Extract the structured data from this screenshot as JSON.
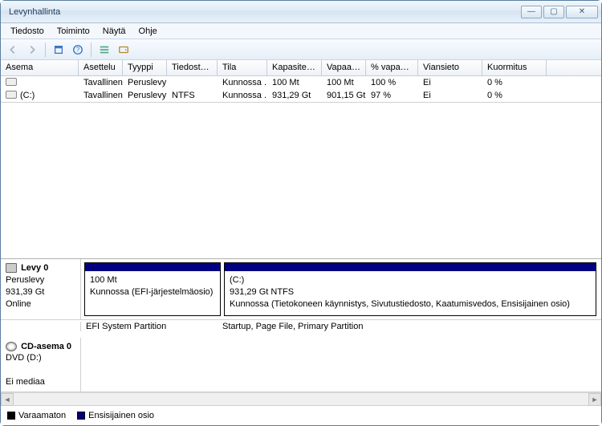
{
  "window": {
    "title": "Levynhallinta"
  },
  "menu": {
    "tiedosto": "Tiedosto",
    "toiminto": "Toiminto",
    "nayta": "Näytä",
    "ohje": "Ohje"
  },
  "columns": {
    "asema": "Asema",
    "asettelu": "Asettelu",
    "tyyppi": "Tyyppi",
    "tj": "Tiedostojärj...",
    "tila": "Tila",
    "kap": "Kapasiteetti",
    "vapaa": "Vapaa tila",
    "pct": "% vapaana",
    "vian": "Viansieto",
    "kuorm": "Kuormitus"
  },
  "volumes": [
    {
      "asema": "",
      "asettelu": "Tavallinen",
      "tyyppi": "Peruslevy",
      "tj": "",
      "tila": "Kunnossa ...",
      "kap": "100 Mt",
      "vapaa": "100 Mt",
      "pct": "100 %",
      "vian": "Ei",
      "kuorm": "0 %"
    },
    {
      "asema": "(C:)",
      "asettelu": "Tavallinen",
      "tyyppi": "Peruslevy",
      "tj": "NTFS",
      "tila": "Kunnossa ...",
      "kap": "931,29 Gt",
      "vapaa": "901,15 Gt",
      "pct": "97 %",
      "vian": "Ei",
      "kuorm": "0 %"
    }
  ],
  "disk0": {
    "title": "Levy 0",
    "type": "Peruslevy",
    "size": "931,39 Gt",
    "status": "Online",
    "vol1": {
      "line1": "",
      "line2": "100 Mt",
      "line3": "Kunnossa (EFI-järjestelmäosio)"
    },
    "vol2": {
      "line1": "(C:)",
      "line2": "931,29 Gt NTFS",
      "line3": "Kunnossa (Tietokoneen käynnistys, Sivutustiedosto, Kaatumisvedos, Ensisijainen osio)"
    }
  },
  "meta": {
    "left": "EFI System Partition",
    "right": "Startup, Page File, Primary Partition"
  },
  "cd": {
    "title": "CD-asema 0",
    "sub": "DVD (D:)",
    "status": "Ei mediaa"
  },
  "legend": {
    "unalloc": "Varaamaton",
    "primary": "Ensisijainen osio"
  }
}
